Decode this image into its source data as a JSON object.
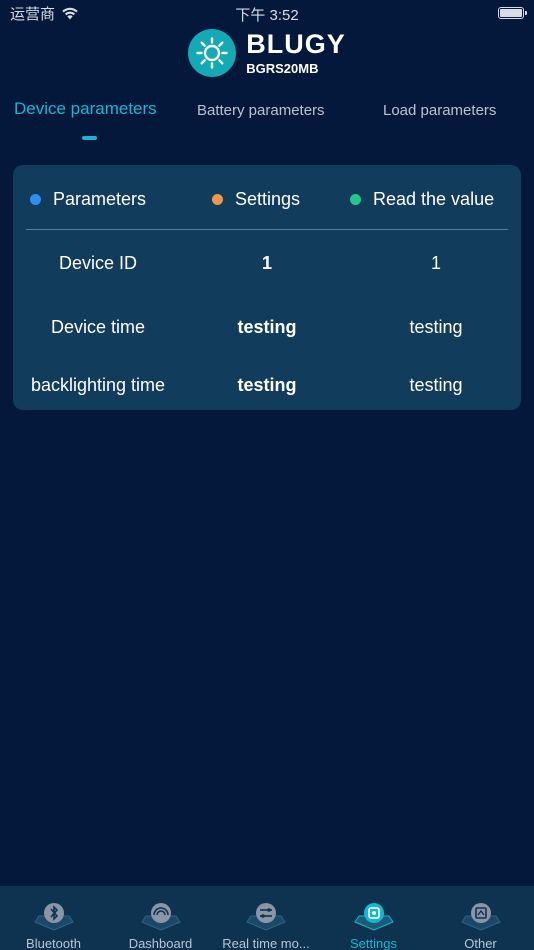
{
  "status_bar": {
    "carrier": "运营商",
    "time": "下午 3:52"
  },
  "brand": {
    "name": "BLUGY",
    "model": "BGRS20MB",
    "logo_color": "#13a9b5"
  },
  "tabs": [
    {
      "label": "Device parameters",
      "active": true
    },
    {
      "label": "Battery parameters",
      "active": false
    },
    {
      "label": "Load parameters",
      "active": false
    }
  ],
  "card": {
    "legend": [
      {
        "label": "Parameters",
        "color": "#2e8ef7"
      },
      {
        "label": "Settings",
        "color": "#f0964c"
      },
      {
        "label": "Read the value",
        "color": "#22c98f"
      }
    ],
    "rows": [
      {
        "parameter": "Device ID",
        "setting": "1",
        "value": "1"
      },
      {
        "parameter": "Device time",
        "setting": "testing",
        "value": "testing"
      },
      {
        "parameter": "backlighting time",
        "setting": "testing",
        "value": "testing"
      }
    ]
  },
  "tabbar": {
    "items": [
      {
        "label": "Bluetooth",
        "icon": "bluetooth-icon",
        "active": false
      },
      {
        "label": "Dashboard",
        "icon": "dashboard-icon",
        "active": false
      },
      {
        "label": "Real time mo...",
        "icon": "realtime-icon",
        "active": false
      },
      {
        "label": "Settings",
        "icon": "settings-icon",
        "active": true
      },
      {
        "label": "Other",
        "icon": "other-icon",
        "active": false
      }
    ]
  },
  "colors": {
    "background": "#03183a",
    "accent": "#19b6d2",
    "card": "#123c5c",
    "tabbar": "#0d3350"
  }
}
